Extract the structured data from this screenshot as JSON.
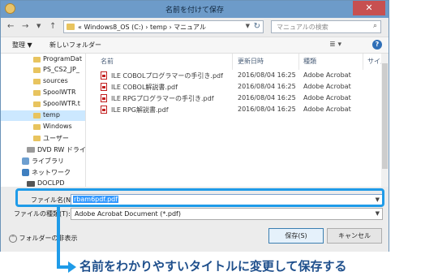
{
  "window": {
    "title": "名前を付けて保存",
    "close_glyph": "✕"
  },
  "nav": {
    "back": "←",
    "forward": "→",
    "up": "↑",
    "path": "« Windows8_OS (C:) › temp › マニュアル",
    "dropdown": "▼",
    "refresh": "↻"
  },
  "search": {
    "placeholder": "マニュアルの検索",
    "icon": "⌕"
  },
  "toolbar": {
    "organize": "整理 ▼",
    "new_folder": "新しいフォルダー",
    "view_icon": "≣ ▾",
    "help": "?"
  },
  "tree": [
    {
      "label": "ProgramDat",
      "type": "folder"
    },
    {
      "label": "PS_CS2_JP_",
      "type": "folder"
    },
    {
      "label": "sources",
      "type": "folder"
    },
    {
      "label": "SpoolWTR",
      "type": "folder"
    },
    {
      "label": "SpoolWTR.t",
      "type": "folder"
    },
    {
      "label": "temp",
      "type": "folder",
      "selected": true
    },
    {
      "label": "Windows",
      "type": "folder"
    },
    {
      "label": "ユーザー",
      "type": "folder"
    },
    {
      "label": "DVD RW ドライ",
      "type": "drive"
    },
    {
      "label": "ライブラリ",
      "type": "library"
    },
    {
      "label": "ネットワーク",
      "type": "network"
    },
    {
      "label": "DOCLPD",
      "type": "drive"
    }
  ],
  "columns": {
    "name": "名前",
    "modified": "更新日時",
    "type": "種類",
    "size": "サイズ"
  },
  "files": [
    {
      "name": "ILE COBOLプログラマーの手引き.pdf",
      "modified": "2016/08/04 16:25",
      "type": "Adobe Acrobat"
    },
    {
      "name": "ILE COBOL解説書.pdf",
      "modified": "2016/08/04 16:25",
      "type": "Adobe Acrobat"
    },
    {
      "name": "ILE RPGプログラマーの手引き.pdf",
      "modified": "2016/08/04 16:25",
      "type": "Adobe Acrobat"
    },
    {
      "name": "ILE RPG解説書.pdf",
      "modified": "2016/08/04 16:25",
      "type": "Adobe Acrobat"
    }
  ],
  "form": {
    "filename_label": "ファイル名(N):",
    "filename_value": "rbam6pdf.pdf",
    "filetype_label": "ファイルの種類(T):",
    "filetype_value": "Adobe Acrobat Document (*.pdf)",
    "hide_folders": "フォルダーの非表示",
    "hide_icon": "^",
    "save": "保存(S)",
    "cancel": "キャンセル",
    "dropdown": "▼"
  },
  "annotation": "名前をわかりやすいタイトルに変更して保存する",
  "colors": {
    "titlebar": "#6d9bc9",
    "accent": "#1f9be8",
    "selection": "#3399ff",
    "annotation_text": "#1e4f8c"
  }
}
